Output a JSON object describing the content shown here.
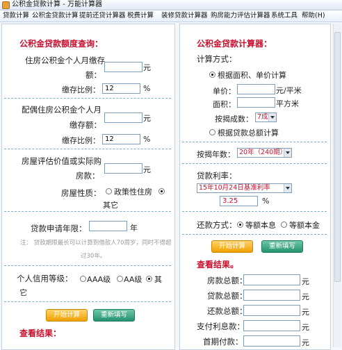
{
  "window": {
    "title": "公积金贷款计算 - 万能计算器"
  },
  "menu": [
    "贷款计算",
    "公积金贷款计算",
    "提前还贷计算器",
    "税费计算",
    "装修贷款计算器",
    "购房能力评估计算器",
    "系统工具",
    "帮助(H)"
  ],
  "left": {
    "heading": "公积金贷款额度查询：",
    "own_fund_label_1": "住房公积金个人月缴存",
    "own_fund_label_2": "额：",
    "unit_yuan": "元",
    "ratio_label": "缴存比例：",
    "own_ratio_value": "12",
    "percent": "%",
    "spouse_label_1": "配偶住房公积金个人月",
    "spouse_label_2": "缴存额：",
    "spouse_ratio_value": "12",
    "house_value_label_1": "房屋评估价值或实际购",
    "house_value_label_2": "房款：",
    "house_type_label": "房屋性质：",
    "house_type_opt1": "政策性住房",
    "house_type_opt2": "其它",
    "years_label": "贷款申请年限：",
    "years_unit": "年",
    "note_1": "注：  贷款期限最长可以计算到借款人70周岁，同时不得超",
    "note_2": "过30年。",
    "credit_label": "个人信用等级：",
    "credit_opt1": "AAA级",
    "credit_opt2": "AA级",
    "credit_opt3": "其",
    "credit_opt3_b": "它",
    "calc_button": "开始计算",
    "reset_button": "重新填写",
    "result_heading": "查看结果："
  },
  "right": {
    "heading": "公积金贷款计算器：",
    "method_label": "计算方式：",
    "method_opt1": "根据面积、单价计算",
    "price_label": "单价：",
    "price_unit": "元/平米",
    "area_label": "面积：",
    "area_unit": "平方米",
    "ratio_label": "按揭成数：",
    "ratio_value": "7成",
    "method_opt2": "根据贷款总额计算",
    "years_label": "按揭年数：",
    "years_value": "20年（240期）",
    "rate_label": "贷款利率：",
    "rate_select_value": "15年10月24日基准利率",
    "rate_value": "3.25",
    "percent": "%",
    "repay_label": "还款方式：",
    "repay_opt1": "等额本息",
    "repay_opt2": "等额本金",
    "calc_button": "开始计算",
    "reset_button": "重新填写",
    "result_heading": "查看结果。",
    "results": [
      {
        "label": "房款总额：",
        "unit": "元"
      },
      {
        "label": "贷款总额：",
        "unit": "元"
      },
      {
        "label": "还款总额：",
        "unit": "元"
      },
      {
        "label": "支付利息款：",
        "unit": "元"
      },
      {
        "label": "首期付款：",
        "unit": "元"
      }
    ]
  }
}
